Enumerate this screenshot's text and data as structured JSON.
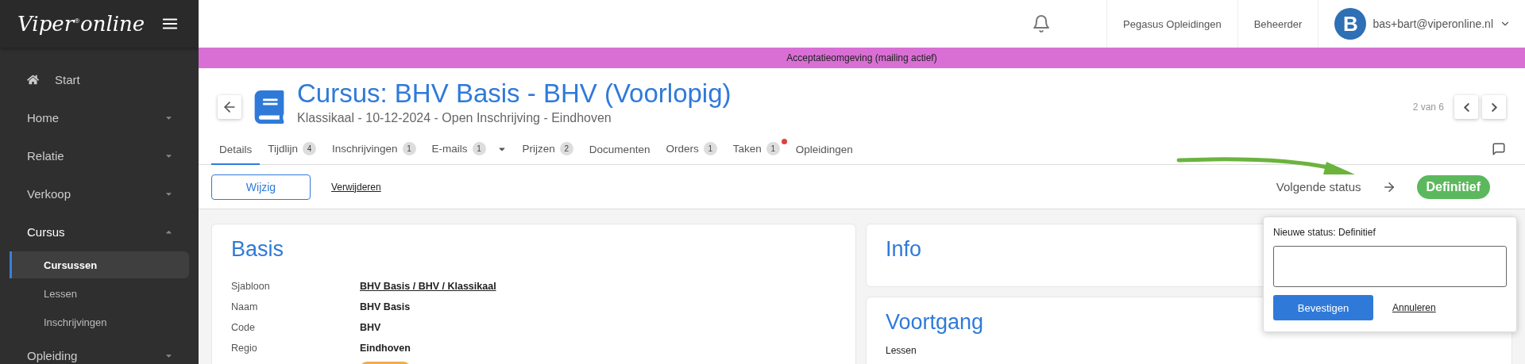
{
  "logo": {
    "text": "Viper",
    "mark": "®",
    "suffix": "online"
  },
  "sidebar": {
    "items": [
      {
        "kind": "link",
        "label": "Start"
      },
      {
        "kind": "group",
        "label": "Home",
        "expanded": false
      },
      {
        "kind": "group",
        "label": "Relatie",
        "expanded": false
      },
      {
        "kind": "group",
        "label": "Verkoop",
        "expanded": false
      },
      {
        "kind": "group",
        "label": "Cursus",
        "expanded": true,
        "children": [
          {
            "label": "Cursussen",
            "selected": true
          },
          {
            "label": "Lessen",
            "selected": false
          },
          {
            "label": "Inschrijvingen",
            "selected": false
          }
        ]
      },
      {
        "kind": "group",
        "label": "Opleiding",
        "expanded": false
      }
    ]
  },
  "topbar": {
    "organisation": "Pegasus Opleidingen",
    "role": "Beheerder",
    "avatar": "B",
    "user": "bas+bart@viperonline.nl"
  },
  "banner": "Acceptatieomgeving (mailing actief)",
  "page": {
    "title": "Cursus: BHV Basis - BHV (Voorlopig)",
    "subtitle": "Klassikaal - 10-12-2024 - Open Inschrijving - Eindhoven",
    "pager": "2 van 6"
  },
  "tabs": [
    {
      "label": "Details",
      "selected": true
    },
    {
      "label": "Tijdlijn",
      "count": "4",
      "selected": false
    },
    {
      "label": "Inschrijvingen",
      "count": "1",
      "selected": false
    },
    {
      "label": "E-mails",
      "count": "1",
      "selected": false,
      "menu": true
    },
    {
      "label": "Prijzen",
      "count": "2",
      "selected": false
    },
    {
      "label": "Documenten",
      "selected": false
    },
    {
      "label": "Orders",
      "count": "1",
      "selected": false
    },
    {
      "label": "Taken",
      "count": "1",
      "selected": false,
      "alert": true
    },
    {
      "label": "Opleidingen",
      "selected": false
    }
  ],
  "actions": {
    "edit": "Wijzig",
    "delete": "Verwijderen",
    "next_status_label": "Volgende status",
    "next_status": "Definitief"
  },
  "basis": {
    "title": "Basis",
    "rows": [
      {
        "label": "Sjabloon",
        "value": "BHV Basis / BHV / Klassikaal",
        "kind": "link"
      },
      {
        "label": "Naam",
        "value": "BHV Basis",
        "kind": "text"
      },
      {
        "label": "Code",
        "value": "BHV",
        "kind": "text"
      },
      {
        "label": "Regio",
        "value": "Eindhoven",
        "kind": "text"
      },
      {
        "kind": "badge",
        "color": "#f0ad4e"
      }
    ]
  },
  "info": {
    "title": "Info"
  },
  "voortgang": {
    "title": "Voortgang",
    "label": "Lessen"
  },
  "popover": {
    "title": "Nieuwe status: Definitief",
    "confirm": "Bevestigen",
    "cancel": "Annuleren"
  }
}
